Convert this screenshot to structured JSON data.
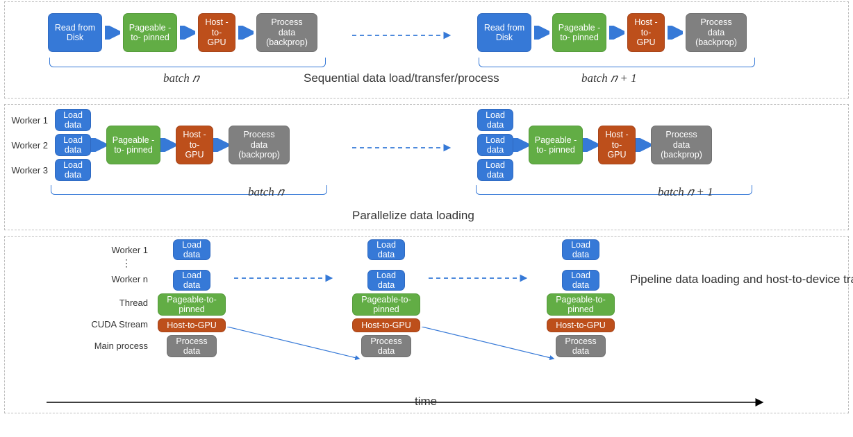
{
  "common": {
    "read_disk": "Read from Disk",
    "load_data": "Load data",
    "pageable": "Pageable -to- pinned",
    "pageable2": "Pageable-to- pinned",
    "host_gpu": "Host -to- GPU",
    "host_gpu2": "Host-to-GPU",
    "process_bp": "Process data (backprop)",
    "process": "Process data",
    "batch_n": "batch 𝑛",
    "batch_n1": "batch 𝑛 + 1",
    "time": "time"
  },
  "panel1": {
    "title": "Sequential data load/transfer/process"
  },
  "panel2": {
    "title": "Parallelize data loading",
    "worker1": "Worker 1",
    "worker2": "Worker 2",
    "worker3": "Worker 3"
  },
  "panel3": {
    "title": "Pipeline data loading and host-to-device transfer of next batch with processing current batch",
    "worker1": "Worker 1",
    "workern": "Worker n",
    "thread": "Thread",
    "cuda": "CUDA Stream",
    "main": "Main process"
  }
}
